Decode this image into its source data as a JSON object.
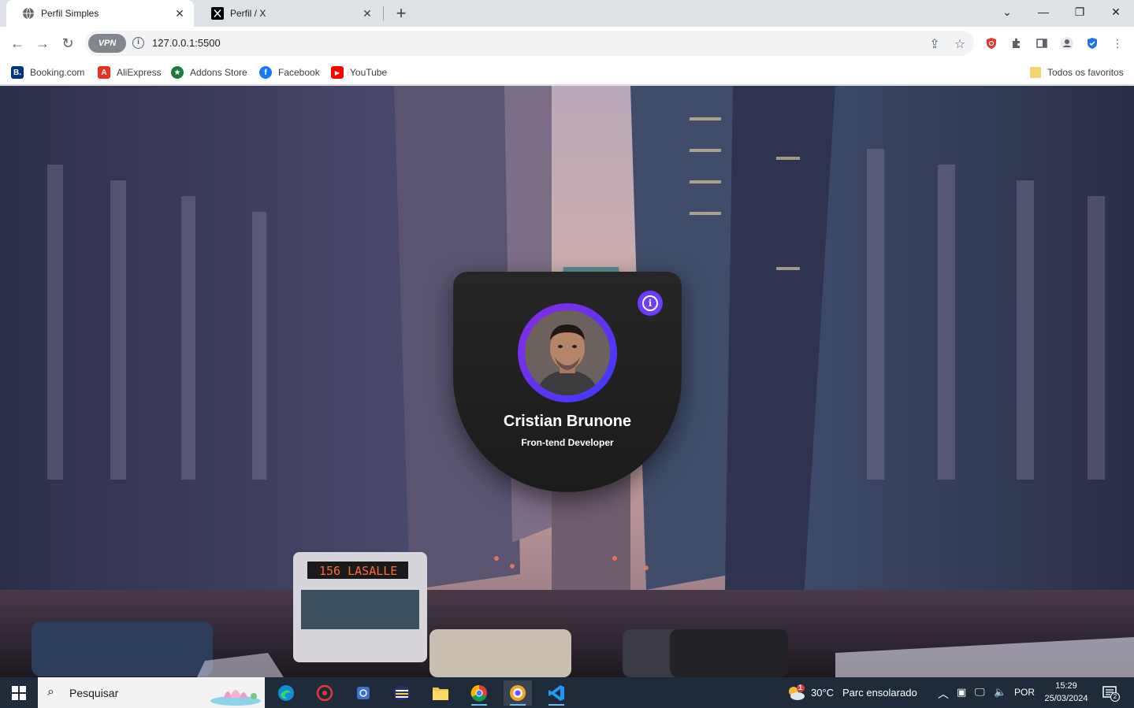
{
  "browser": {
    "tabs": [
      {
        "title": "Perfil Simples",
        "active": true,
        "icon": "globe-icon"
      },
      {
        "title": "Perfil / X",
        "active": false,
        "icon": "x-logo-icon"
      }
    ],
    "url": "127.0.0.1:5500",
    "vpn_label": "VPN"
  },
  "bookmarks": {
    "items": [
      {
        "label": "Booking.com",
        "icon": "booking-icon",
        "color": "#003580",
        "glyph": "B."
      },
      {
        "label": "AliExpress",
        "icon": "aliexpress-icon",
        "color": "#e43225",
        "glyph": "A"
      },
      {
        "label": "Addons Store",
        "icon": "addons-store-icon",
        "color": "#1e7a3c",
        "glyph": "★"
      },
      {
        "label": "Facebook",
        "icon": "facebook-icon",
        "color": "#1877f2",
        "glyph": "f"
      },
      {
        "label": "YouTube",
        "icon": "youtube-icon",
        "color": "#ff0000",
        "glyph": "▶"
      }
    ],
    "all_bookmarks": "Todos os favoritos"
  },
  "profile_card": {
    "name": "Cristian Brunone",
    "role": "Fron-tend Developer",
    "ring_colors": [
      "#8a2be2",
      "#3b3bff"
    ],
    "info_button_color": "#6c3cff"
  },
  "taskbar": {
    "search_placeholder": "Pesquisar",
    "weather_temp": "30°C",
    "weather_desc": "Parc ensolarado",
    "language": "POR",
    "time": "15:29",
    "date": "25/03/2024",
    "notification_count": "2",
    "weather_badge": "1"
  }
}
